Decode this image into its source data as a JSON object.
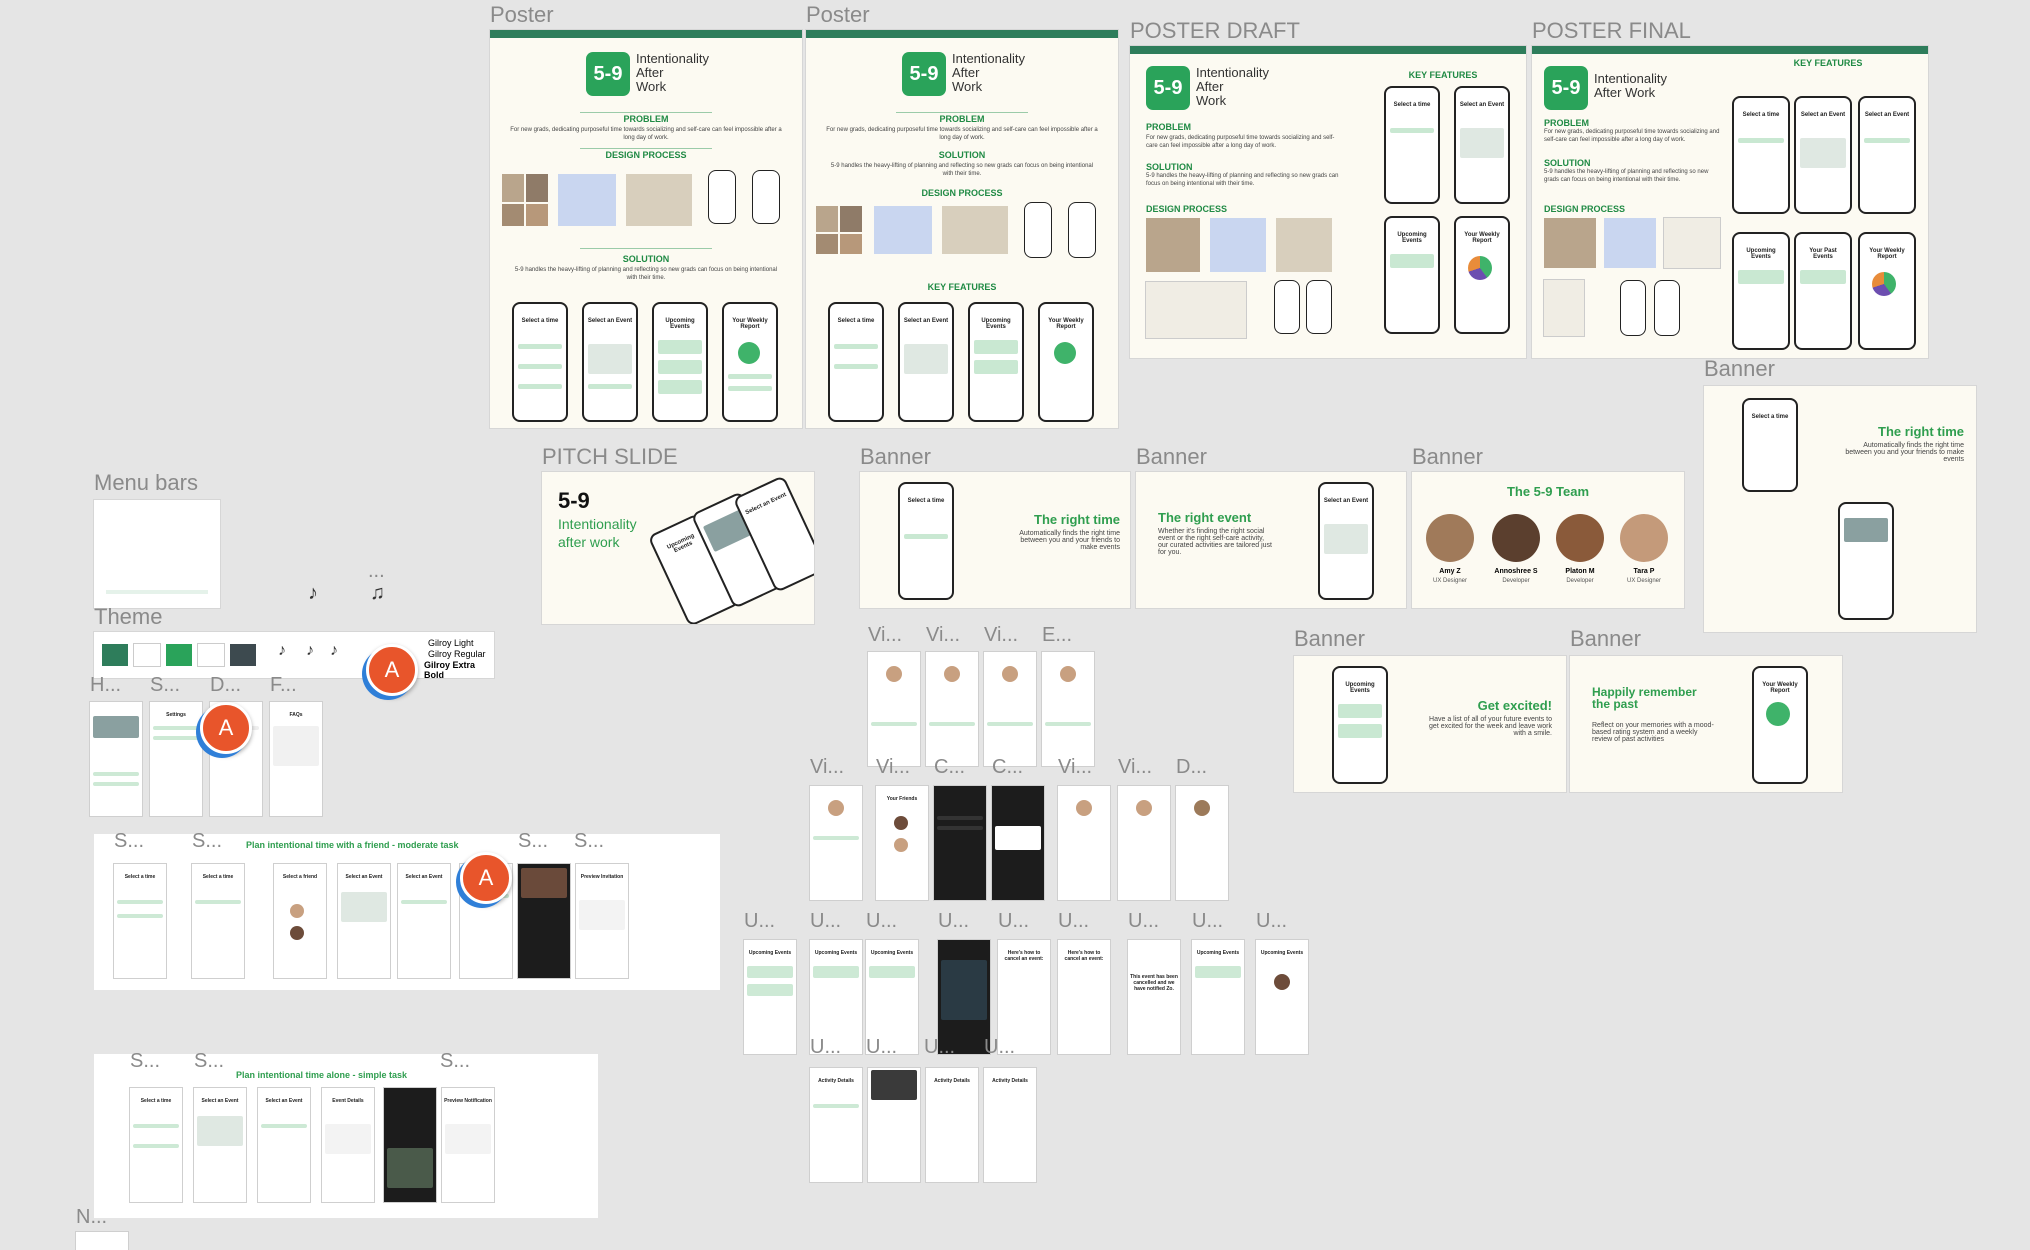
{
  "labels": {
    "poster1": "Poster",
    "poster2": "Poster",
    "poster_draft": "POSTER DRAFT",
    "poster_final": "POSTER FINAL",
    "banner_right": "Banner",
    "pitch_slide": "PITCH SLIDE",
    "banner1": "Banner",
    "banner2": "Banner",
    "banner3": "Banner",
    "banner4": "Banner",
    "banner5": "Banner",
    "menu_bars": "Menu bars",
    "theme": "Theme",
    "ellipsis": "...",
    "h": "H...",
    "s": "S...",
    "d": "D...",
    "f": "F...",
    "vi": "Vi...",
    "e": "E...",
    "c": "C...",
    "u": "U...",
    "n": "N..."
  },
  "poster": {
    "logo": "5-9",
    "title_line1": "Intentionality",
    "title_line2": "After",
    "title_line3": "Work",
    "title_line23": "After Work",
    "problem": "PROBLEM",
    "problem_text": "For new grads, dedicating purposeful time towards socializing and self-care can feel impossible after a long day of work.",
    "design_process": "DESIGN PROCESS",
    "solution": "SOLUTION",
    "solution_text": "5-9 handles the heavy-lifting of planning and reflecting so new grads can focus on being intentional with their time.",
    "key_features": "KEY FEATURES",
    "select_time": "Select a time",
    "select_event": "Select an Event",
    "upcoming": "Upcoming Events",
    "weekly": "Your Weekly Report",
    "past": "Your Past Events"
  },
  "pitch": {
    "logo": "5-9",
    "line1": "Intentionality",
    "line2": "after work"
  },
  "banners": {
    "right_time_title": "The right time",
    "right_time_text": "Automatically finds the right time between you and your friends to make events",
    "right_event_title": "The right event",
    "right_event_text": "Whether it's finding the right social event or the right self-care activity, our curated activities are tailored just for you.",
    "team_title": "The 5-9 Team",
    "team": [
      {
        "name": "Amy Z",
        "role": "UX Designer"
      },
      {
        "name": "Annoshree S",
        "role": "Developer"
      },
      {
        "name": "Platon M",
        "role": "Developer"
      },
      {
        "name": "Tara P",
        "role": "UX Designer"
      }
    ],
    "excited_title": "Get excited!",
    "excited_text": "Have a list of all of your future events to get excited for the week and leave work with a smile.",
    "remember_title": "Happily remember the past",
    "remember_text": "Reflect on your memories with a mood-based rating system and a weekly review of past activities"
  },
  "theme": {
    "fonts": [
      "Gilroy Light",
      "Gilroy Regular",
      "Gilroy Extra Bold"
    ],
    "colors": [
      "#2e7d5b",
      "#ffffff",
      "#2aa35a",
      "#ffffff",
      "#3d4a4f"
    ]
  },
  "flows": {
    "moderate_title": "Plan intentional time with a friend - moderate task",
    "simple_title": "Plan intentional time alone - simple task",
    "screens": {
      "select_time": "Select a time",
      "select_friend": "Select a friend",
      "select_event": "Select an Event",
      "preview_invitation": "Preview Invitation",
      "event_details": "Event Details",
      "preview_notification": "Preview Notification",
      "upcoming": "Upcoming Events",
      "cancel": "Here's how to cancel an event:",
      "cancelled": "This event has been cancelled and we have notified Zo.",
      "activity": "Activity Details",
      "your_friends": "Your Friends",
      "settings": "Settings",
      "faq": "FAQs"
    }
  },
  "collaborator": {
    "initial": "A"
  }
}
